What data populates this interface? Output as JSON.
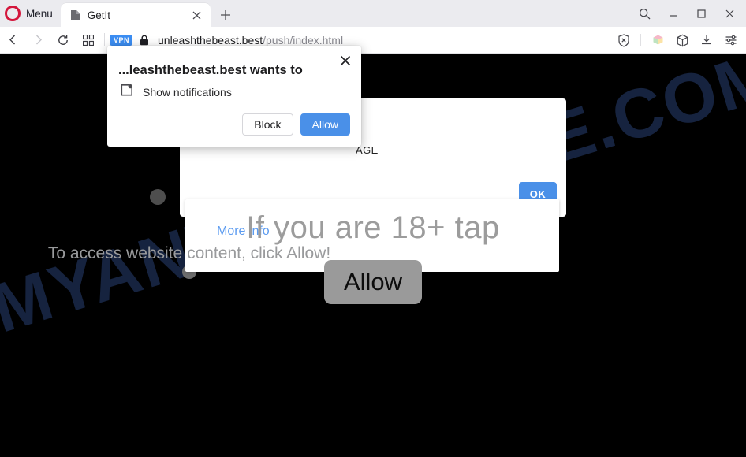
{
  "browser": {
    "name": "Opera",
    "menu_label": "Menu",
    "tabs": [
      {
        "title": "GetIt",
        "favicon": "page-icon",
        "close_icon": "close-icon",
        "active": true
      }
    ],
    "new_tab_icon": "plus-icon",
    "window_controls": [
      {
        "name": "search-icon",
        "glyph": "search"
      },
      {
        "name": "minimize-icon",
        "glyph": "minimize"
      },
      {
        "name": "maximize-icon",
        "glyph": "maximize"
      },
      {
        "name": "close-window-icon",
        "glyph": "close"
      }
    ],
    "navigation": [
      {
        "name": "back-button",
        "icon": "chevron-left-icon",
        "enabled": true
      },
      {
        "name": "forward-button",
        "icon": "chevron-right-icon",
        "enabled": false
      },
      {
        "name": "reload-button",
        "icon": "reload-icon",
        "enabled": true
      },
      {
        "name": "speed-dial-button",
        "icon": "grid-icon",
        "enabled": true
      }
    ],
    "address": {
      "vpn_badge": "VPN",
      "lock_icon": "lock-icon",
      "host": "unleashthebeast.best",
      "path": "/push/index.html"
    },
    "toolbar_icons": [
      {
        "name": "ad-blocker-icon",
        "glyph": "shield-x"
      },
      {
        "name": "extensions-cube-icon",
        "glyph": "color-cube"
      },
      {
        "name": "workspaces-icon",
        "glyph": "cube"
      },
      {
        "name": "downloads-icon",
        "glyph": "download"
      },
      {
        "name": "easy-setup-icon",
        "glyph": "sliders"
      }
    ]
  },
  "permission_dialog": {
    "title": "...leashthebeast.best wants to",
    "permission_icon": "notifications-icon",
    "permission_label": "Show notifications",
    "block_label": "Block",
    "allow_label": "Allow",
    "close_icon": "close-icon",
    "accent_color": "#4a90e8"
  },
  "page": {
    "headline": "If you are 18+ tap",
    "subtext": "To access website content, click Allow!",
    "allow_button": "Allow",
    "background_color": "#000000",
    "allow_button_color": "#9a9a9a",
    "watermark": "MYANTISPYWARE.COM",
    "watermark_color": "#16233f",
    "overlay_back_panel": {
      "text": "AGE",
      "ok_label": "OK",
      "ok_color": "#4a90e8"
    },
    "overlay_front_panel": {
      "more_info_label": "More info",
      "link_color": "#5b9bf0"
    }
  }
}
